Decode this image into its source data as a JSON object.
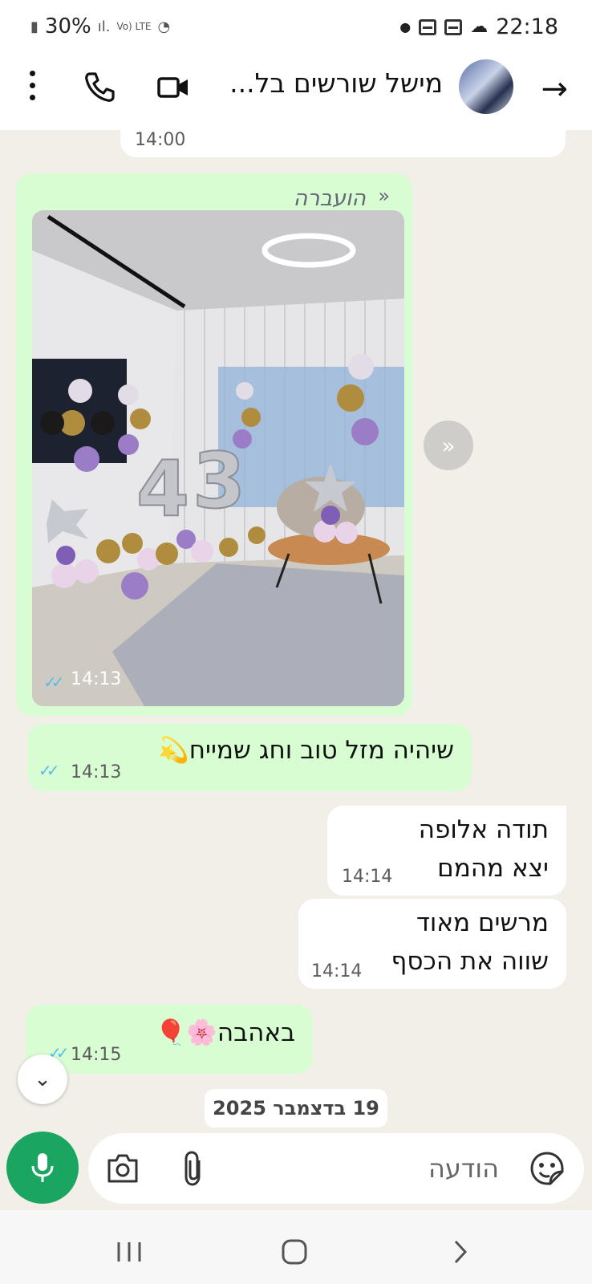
{
  "status_bar": {
    "battery": "30%",
    "network": "Vo) LTE",
    "time": "22:18"
  },
  "header": {
    "title": "מישל שורשים בל...",
    "icons": [
      "back-arrow-icon",
      "video-call-icon",
      "voice-call-icon",
      "more-options-icon"
    ]
  },
  "messages": {
    "top_fragment_time": "14:00",
    "forwarded": {
      "label": "הועברה",
      "time": "14:13"
    },
    "m1": {
      "text": "שיהיה מזל טוב וחג שמייח💫",
      "time": "14:13"
    },
    "m2": {
      "line1": "תודה אלופה",
      "line2": "יצא מהמם",
      "time": "14:14"
    },
    "m3": {
      "line1": "מרשים מאוד",
      "line2": "שווה את הכסף",
      "time": "14:14"
    },
    "m4": {
      "text": "באהבה🌸🎈",
      "time": "14:15"
    }
  },
  "date_divider": "19 בדצמבר 2025",
  "composer": {
    "placeholder": "הודעה"
  },
  "colors": {
    "outgoing_bubble": "#d9fdd3",
    "incoming_bubble": "#ffffff",
    "chat_background": "#f2efe8",
    "accent_green": "#1aa560",
    "read_ticks": "#53bdeb"
  }
}
